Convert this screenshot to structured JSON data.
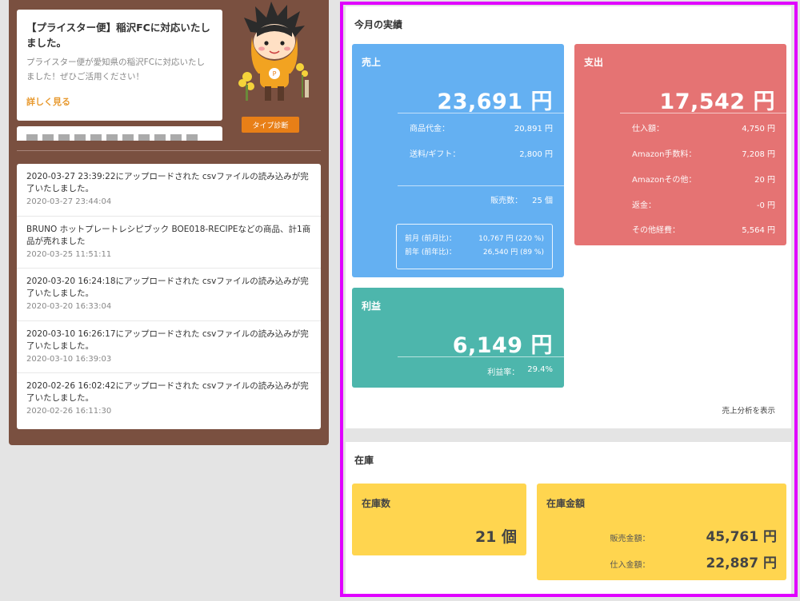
{
  "news": {
    "title": "【プライスター便】稲沢FCに対応いたしました。",
    "body": "プライスター便が愛知県の稲沢FCに対応いたしました！ぜひご活用ください！",
    "more": "詳しく見る",
    "type_button": "タイプ診断"
  },
  "activities": [
    {
      "text": "2020-03-27 23:39:22にアップロードされた csvファイルの読み込みが完了いたしました。",
      "time": "2020-03-27 23:44:04"
    },
    {
      "text": "BRUNO ホットプレートレシピブック BOE018-RECIPEなどの商品、計1商品が売れました",
      "time": "2020-03-25 11:51:11"
    },
    {
      "text": "2020-03-20 16:24:18にアップロードされた csvファイルの読み込みが完了いたしました。",
      "time": "2020-03-20 16:33:04"
    },
    {
      "text": "2020-03-10 16:26:17にアップロードされた csvファイルの読み込みが完了いたしました。",
      "time": "2020-03-10 16:39:03"
    },
    {
      "text": "2020-02-26 16:02:42にアップロードされた csvファイルの読み込みが完了いたしました。",
      "time": "2020-02-26 16:11:30"
    }
  ],
  "monthly": {
    "title": "今月の実績",
    "sales": {
      "label": "売上",
      "total": "23,691 円",
      "rows": [
        {
          "label": "商品代金：",
          "value": "20,891 円"
        },
        {
          "label": "送料/ギフト：",
          "value": "2,800 円"
        }
      ],
      "count_label": "販売数：",
      "count_value": "25 個",
      "compare": [
        {
          "label": "前月 (前月比)：",
          "value": "10,767 円 (220 %)"
        },
        {
          "label": "前年 (前年比)：",
          "value": "26,540 円 (89 %)"
        }
      ]
    },
    "expense": {
      "label": "支出",
      "total": "17,542 円",
      "rows": [
        {
          "label": "仕入額：",
          "value": "4,750 円"
        },
        {
          "label": "Amazon手数料：",
          "value": "7,208 円"
        },
        {
          "label": "Amazonその他：",
          "value": "20 円"
        },
        {
          "label": "返金：",
          "value": "-0 円"
        },
        {
          "label": "その他経費：",
          "value": "5,564 円"
        }
      ]
    },
    "profit": {
      "label": "利益",
      "total": "6,149 円",
      "rate_label": "利益率：",
      "rate_value": "29.4%"
    },
    "analysis_link": "売上分析を表示"
  },
  "stock": {
    "title": "在庫",
    "count_label": "在庫数",
    "count_value": "21 個",
    "amount_label": "在庫金額",
    "sale_amount_label": "販売金額：",
    "sale_amount_value": "45,761 円",
    "cost_amount_label": "仕入金額：",
    "cost_amount_value": "22,887 円"
  },
  "colors": {
    "sales": "#64b0f2",
    "expense": "#e57373",
    "profit": "#4db6ac",
    "stock": "#ffd54f",
    "highlight": "#e000ff",
    "panel": "#7a5040"
  }
}
